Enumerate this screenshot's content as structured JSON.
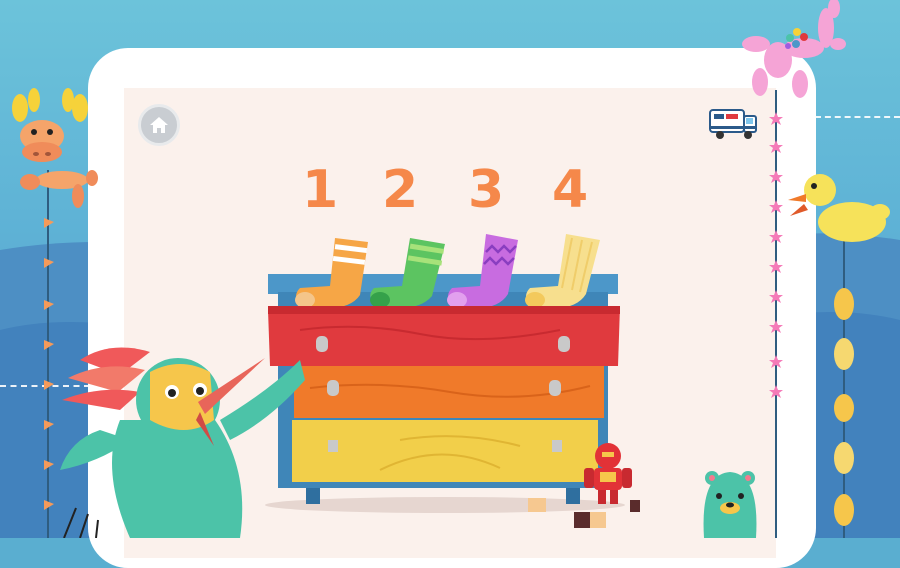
{
  "game": {
    "numbers": [
      "1",
      "2",
      "3",
      "4"
    ]
  },
  "colors": {
    "sky": "#6cc3da",
    "screen": "#fbf1ec",
    "number": "#f5884a",
    "dresser_top_drawer": "#e03a3e",
    "dresser_middle_drawer": "#f07a2a",
    "dresser_bottom_drawer": "#f2cf4a",
    "dresser_frame": "#3f86b8"
  },
  "icons": {
    "home": "home-icon",
    "truck": "truck-icon",
    "moose": "balloon-moose-icon",
    "dog": "balloon-dog-icon",
    "duck": "balloon-duck-icon",
    "bird": "woodpecker-icon",
    "robot": "robot-toy-icon",
    "bear": "bear-icon"
  },
  "socks": [
    {
      "color": "orange-striped"
    },
    {
      "color": "green-striped"
    },
    {
      "color": "purple-zigzag"
    },
    {
      "color": "yellow-ribbed"
    }
  ]
}
